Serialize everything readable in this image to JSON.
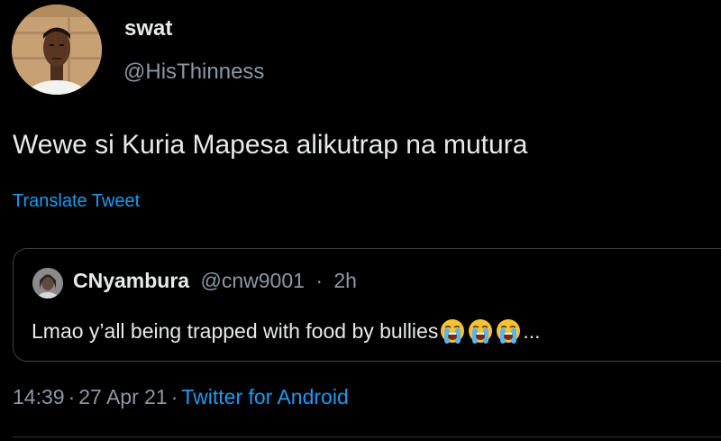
{
  "author": {
    "display_name": "swat",
    "handle": "@HisThinness",
    "avatar_icon": "profile-photo"
  },
  "tweet": {
    "text": "Wewe si Kuria Mapesa alikutrap na mutura",
    "translate_label": "Translate Tweet"
  },
  "quoted_tweet": {
    "display_name": "CNyambura",
    "handle": "@cnw9001",
    "separator": "·",
    "age": "2h",
    "text": "Lmao y’all being trapped with food by bullies",
    "emojis": [
      "loudly-crying-face-icon",
      "loudly-crying-face-icon",
      "loudly-crying-face-icon"
    ],
    "ellipsis": "..."
  },
  "meta": {
    "time": "14:39",
    "date": "27 Apr 21",
    "separator": "·",
    "source": "Twitter for Android"
  },
  "colors": {
    "background": "#000000",
    "primary_text": "#e7e9ea",
    "secondary_text": "#8b98a5",
    "link": "#1d9bf0",
    "border": "#3e4144",
    "emoji_face": "#f7c331"
  }
}
